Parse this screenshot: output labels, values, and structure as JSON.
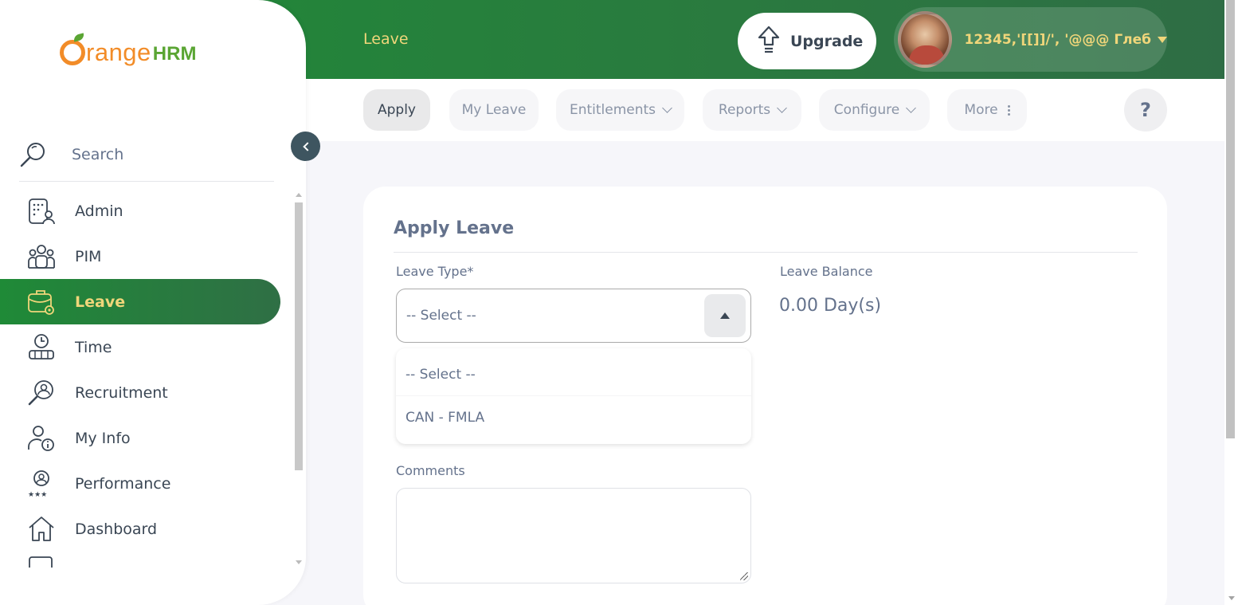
{
  "header": {
    "module_title": "Leave",
    "upgrade_label": "Upgrade",
    "user_name": "12345,'[[]]/', '@@@ Глеб"
  },
  "tabs": [
    {
      "label": "Apply",
      "active": true
    },
    {
      "label": "My Leave"
    },
    {
      "label": "Entitlements",
      "has_dropdown": true
    },
    {
      "label": "Reports",
      "has_dropdown": true
    },
    {
      "label": "Configure",
      "has_dropdown": true
    },
    {
      "label": "More",
      "has_menu": true
    }
  ],
  "help_label": "?",
  "sidebar": {
    "logo_main": "range",
    "logo_suffix": "HRM",
    "search_label": "Search",
    "items": [
      {
        "label": "Admin",
        "icon": "admin-icon"
      },
      {
        "label": "PIM",
        "icon": "pim-icon"
      },
      {
        "label": "Leave",
        "icon": "leave-icon",
        "active": true
      },
      {
        "label": "Time",
        "icon": "time-icon"
      },
      {
        "label": "Recruitment",
        "icon": "recruitment-icon"
      },
      {
        "label": "My Info",
        "icon": "my-info-icon"
      },
      {
        "label": "Performance",
        "icon": "performance-icon"
      },
      {
        "label": "Dashboard",
        "icon": "dashboard-icon"
      }
    ]
  },
  "form": {
    "title": "Apply Leave",
    "leave_type_label": "Leave Type*",
    "leave_type_value": "-- Select --",
    "leave_type_options": [
      "-- Select --",
      "CAN - FMLA"
    ],
    "leave_balance_label": "Leave Balance",
    "leave_balance_value": "0.00 Day(s)",
    "comments_label": "Comments"
  },
  "colors": {
    "brand_green": "#1f8a37",
    "accent_yellow": "#f0d67a",
    "logo_orange": "#f28c28",
    "text_gray": "#64728c"
  }
}
